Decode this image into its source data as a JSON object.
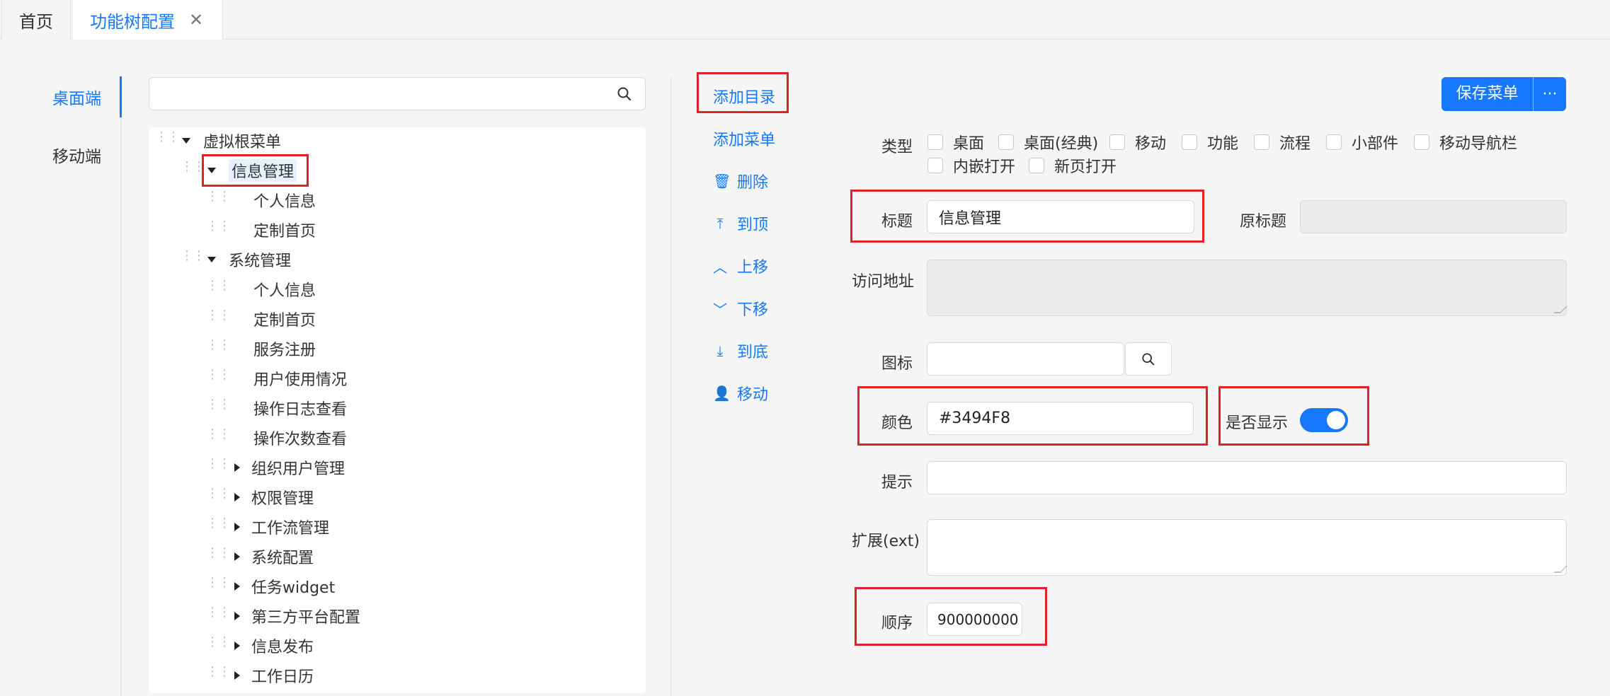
{
  "tabs": {
    "home": "首页",
    "active": "功能树配置",
    "close": "✕"
  },
  "sidenav": {
    "desktop": "桌面端",
    "mobile": "移动端"
  },
  "search": {
    "placeholder": ""
  },
  "tree": {
    "root": "虚拟根菜单",
    "n1": "信息管理",
    "n1_1": "个人信息",
    "n1_2": "定制首页",
    "n2": "系统管理",
    "n2_1": "个人信息",
    "n2_2": "定制首页",
    "n2_3": "服务注册",
    "n2_4": "用户使用情况",
    "n2_5": "操作日志查看",
    "n2_6": "操作次数查看",
    "n2_7": "组织用户管理",
    "n2_8": "权限管理",
    "n2_9": "工作流管理",
    "n2_10": "系统配置",
    "n2_11": "任务widget",
    "n2_12": "第三方平台配置",
    "n2_13": "信息发布",
    "n2_14": "工作日历"
  },
  "actions": {
    "add_dir": "添加目录",
    "add_menu": "添加菜单",
    "delete": "删除",
    "top": "到顶",
    "up": "上移",
    "down": "下移",
    "bottom": "到底",
    "move": "移动"
  },
  "form": {
    "save": "保存菜单",
    "more": "···",
    "type_label": "类型",
    "types": [
      "桌面",
      "桌面(经典)",
      "移动",
      "功能",
      "流程",
      "小部件",
      "移动导航栏",
      "内嵌打开",
      "新页打开"
    ],
    "title_label": "标题",
    "title_value": "信息管理",
    "orig_title_label": "原标题",
    "url_label": "访问地址",
    "icon_label": "图标",
    "color_label": "颜色",
    "color_value": "#3494F8",
    "show_label": "是否显示",
    "hint_label": "提示",
    "ext_label": "扩展(ext)",
    "order_label": "顺序",
    "order_value": "900000000"
  },
  "colors": {
    "accent": "#1677ff",
    "highlight": "#e0202a"
  }
}
